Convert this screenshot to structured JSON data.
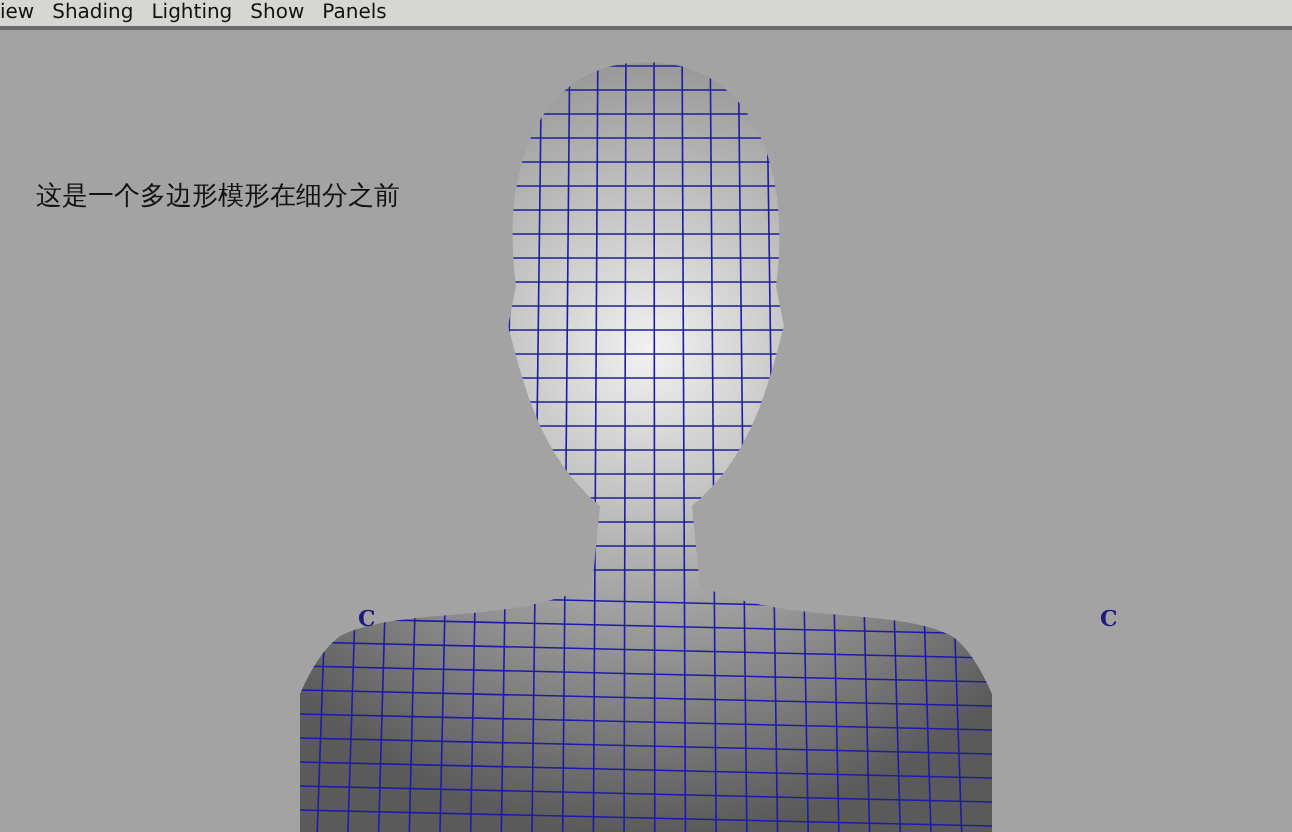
{
  "menu_bar": {
    "items": [
      "iew",
      "Shading",
      "Lighting",
      "Show",
      "Panels"
    ]
  },
  "viewport": {
    "caption": "这是一个多边形模形在细分之前",
    "markers": [
      "C",
      "C"
    ]
  }
}
